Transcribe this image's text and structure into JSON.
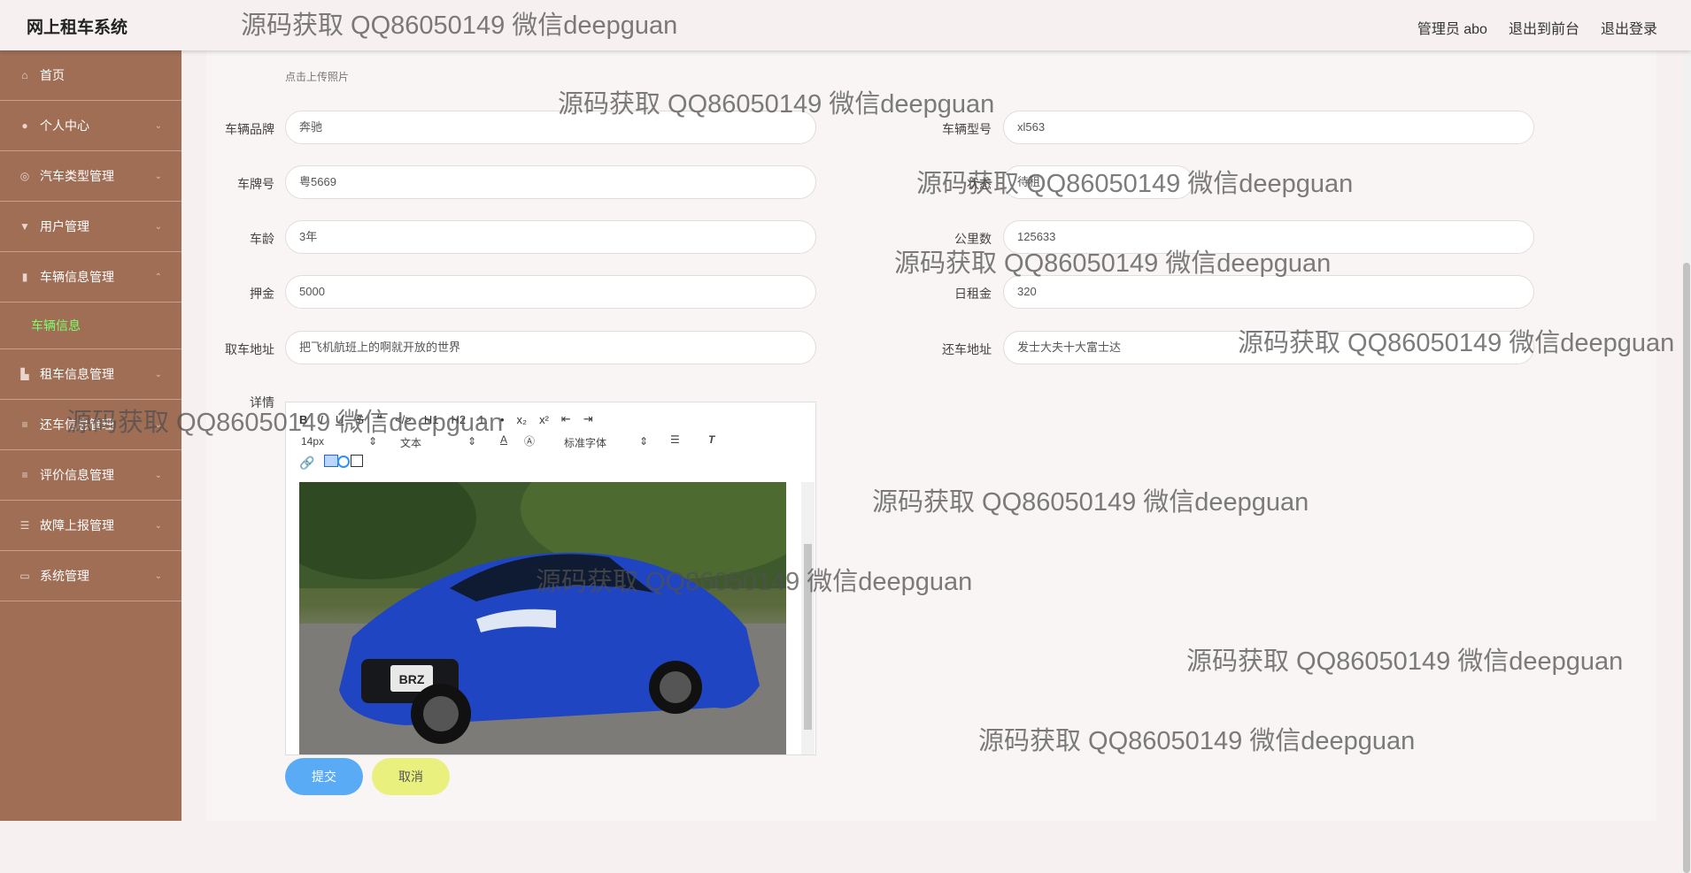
{
  "app": {
    "title": "网上租车系统"
  },
  "header": {
    "user": "管理员 abo",
    "front": "退出到前台",
    "logout": "退出登录"
  },
  "sidebar": {
    "items": [
      {
        "label": "首页",
        "icon": "home-icon"
      },
      {
        "label": "个人中心",
        "icon": "user-icon"
      },
      {
        "label": "汽车类型管理",
        "icon": "gear-icon"
      },
      {
        "label": "用户管理",
        "icon": "pin-icon"
      },
      {
        "label": "车辆信息管理",
        "icon": "bar-chart-icon"
      },
      {
        "label": "车辆信息",
        "icon": ""
      },
      {
        "label": "租车信息管理",
        "icon": "chart-icon"
      },
      {
        "label": "还车信息管理",
        "icon": "list-icon"
      },
      {
        "label": "评价信息管理",
        "icon": "list-icon"
      },
      {
        "label": "故障上报管理",
        "icon": "sliders-icon"
      },
      {
        "label": "系统管理",
        "icon": "monitor-icon"
      }
    ]
  },
  "form": {
    "upload_hint": "点击上传照片",
    "brand_label": "车辆品牌",
    "brand_value": "奔驰",
    "model_label": "车辆型号",
    "model_value": "xl563",
    "plate_label": "车牌号",
    "plate_value": "粤5669",
    "status_label": "状态",
    "status_value": "待租",
    "age_label": "车龄",
    "age_value": "3年",
    "mileage_label": "公里数",
    "mileage_value": "125633",
    "deposit_label": "押金",
    "deposit_value": "5000",
    "daily_label": "日租金",
    "daily_value": "320",
    "pickup_label": "取车地址",
    "pickup_value": "把飞机航班上的啊就开放的世界",
    "return_label": "还车地址",
    "return_value": "发士大夫十大富士达",
    "detail_label": "详情"
  },
  "editor": {
    "font_size": "14px",
    "block": "文本",
    "font": "标准字体",
    "toolbar_row1": [
      "B",
      "I",
      "U",
      "S",
      "❝",
      "</>",
      "H1",
      "H2",
      "1.",
      "•",
      "x₂",
      "x²",
      "⇤",
      "⇥"
    ],
    "image_alt": "SUBARU BRZ"
  },
  "buttons": {
    "submit": "提交",
    "cancel": "取消"
  },
  "watermark": "源码获取 QQ86050149 微信deepguan",
  "colors": {
    "sidebar": "#a06d55",
    "submit": "#5aabf5",
    "cancel": "#eaf07e",
    "active_sub": "#7cff6b"
  }
}
